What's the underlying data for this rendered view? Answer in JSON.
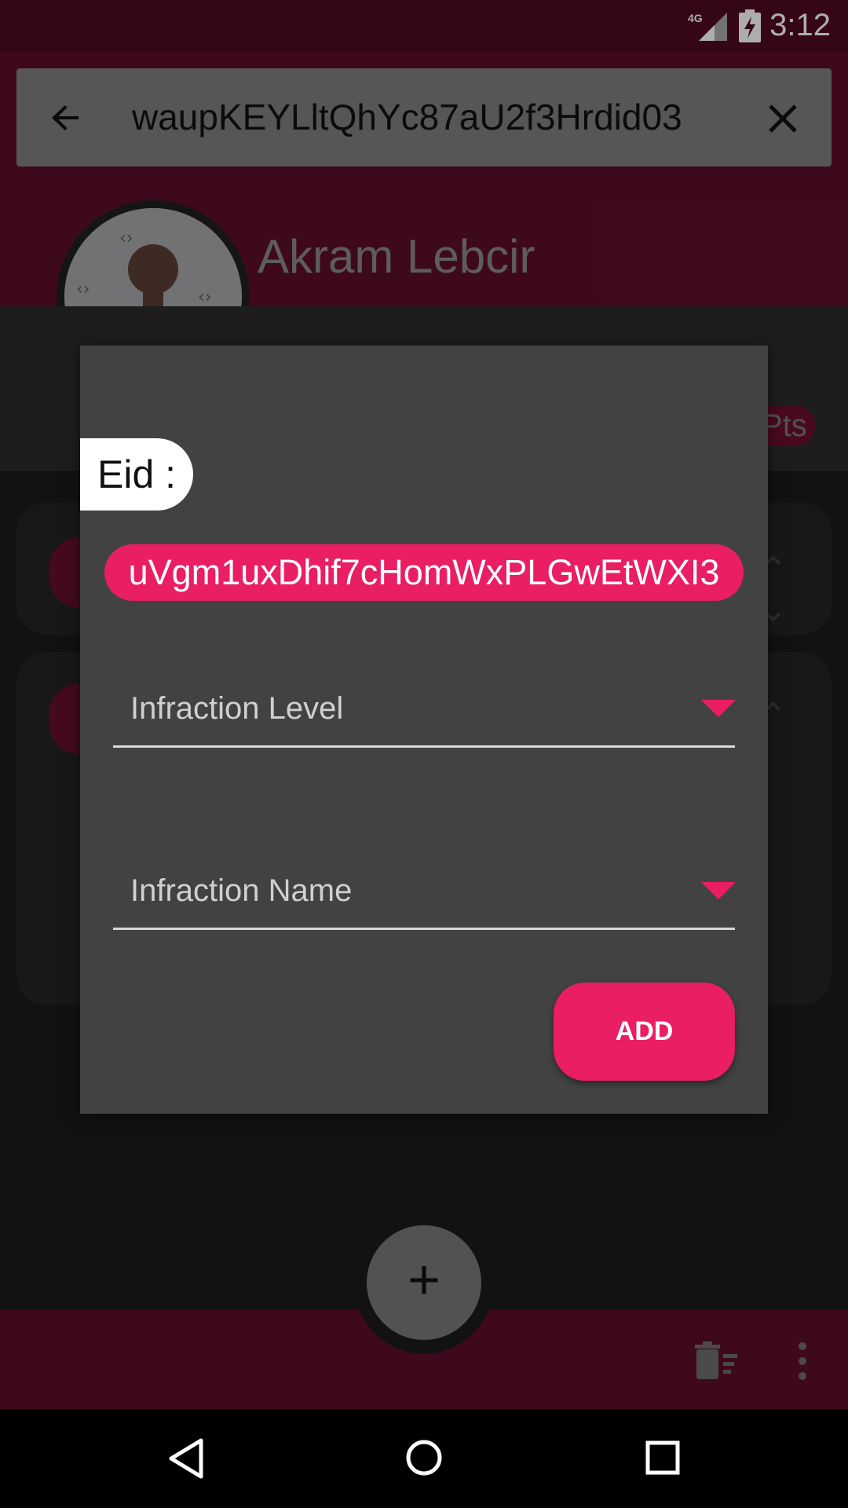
{
  "status_bar": {
    "time": "3:12",
    "network": "4G"
  },
  "search": {
    "query": "waupKEYLltQhYc87aU2f3Hrdid03",
    "back_icon": "arrow-left-icon",
    "clear_icon": "close-icon"
  },
  "profile": {
    "name": "Akram Lebcir",
    "side_text": "s",
    "points_badge": "Pts"
  },
  "dialog": {
    "eid_label": "Eid :",
    "eid_value": "uVgm1uxDhif7cHomWxPLGwEtWXI3",
    "infraction_level_label": "Infraction Level",
    "infraction_name_label": "Infraction Name",
    "add_button": "ADD"
  },
  "fab": {
    "label": "+"
  },
  "colors": {
    "accent": "#e91e63",
    "primary_dark": "#4f0a22",
    "primary": "#5e0e2c",
    "dialog_bg": "#424242"
  }
}
